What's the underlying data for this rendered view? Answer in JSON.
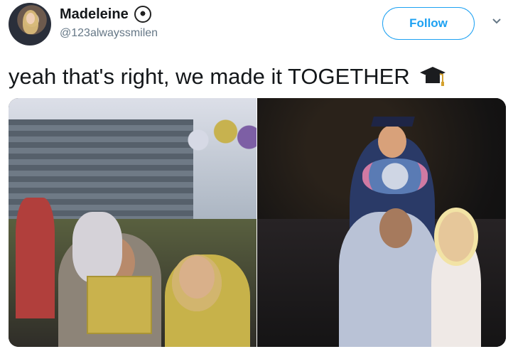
{
  "user": {
    "name": "Madeleine",
    "handle": "@123alwayssmilen",
    "badge_icon": "soccer-ball-icon"
  },
  "header": {
    "follow_label": "Follow",
    "menu_icon": "chevron-down-icon"
  },
  "tweet": {
    "text": "yeah that's right, we made it TOGETHER",
    "emoji_icon": "graduation-cap-icon"
  },
  "media": {
    "count": 2
  },
  "colors": {
    "accent": "#1da1f2",
    "text": "#14171a",
    "secondary_text": "#657786"
  }
}
